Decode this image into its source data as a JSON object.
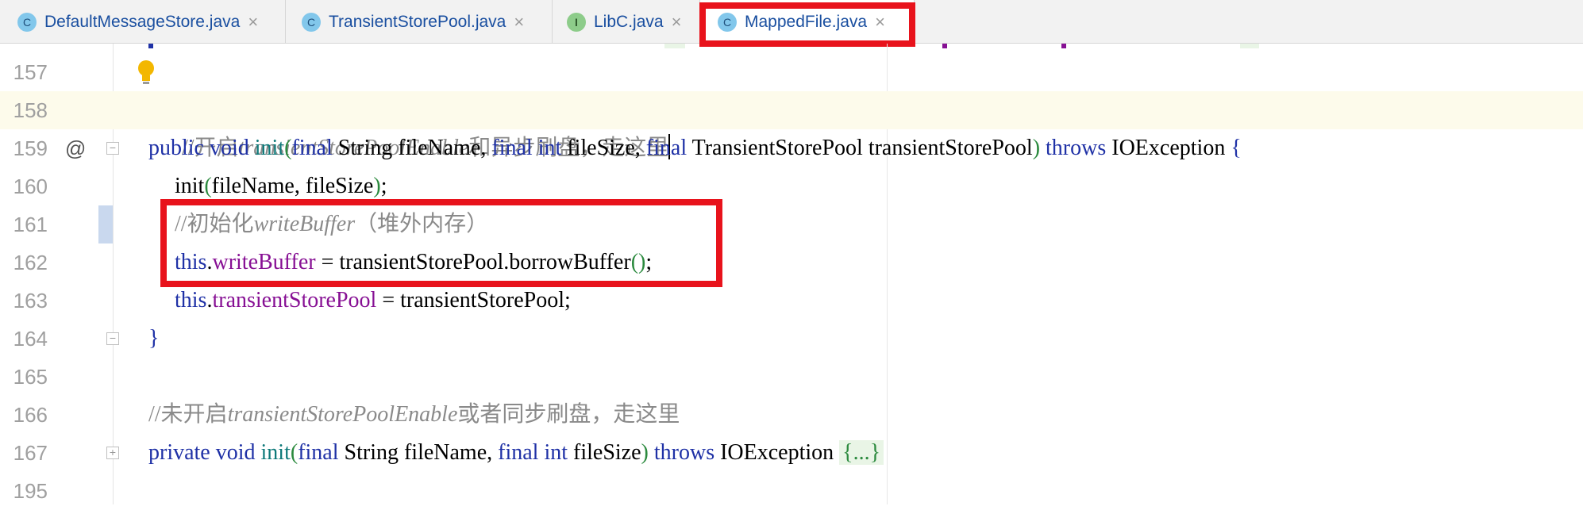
{
  "tabs": [
    {
      "icon_letter": "C",
      "label": "DefaultMessageStore.java",
      "close": "×"
    },
    {
      "icon_letter": "C",
      "label": "TransientStorePool.java",
      "close": "×"
    },
    {
      "icon_letter": "I",
      "label": "LibC.java",
      "close": "×"
    },
    {
      "icon_letter": "C",
      "label": "MappedFile.java",
      "close": "×",
      "active": true
    }
  ],
  "gutter": {
    "override_marker": "@"
  },
  "code_lines": {
    "l157": {
      "num": "157"
    },
    "l158": {
      "num": "158",
      "c1": "//开启",
      "c2": "transientStorePoolEnable",
      "c3": "和异步刷盘，走这里"
    },
    "l159": {
      "num": "159",
      "t1": "public",
      "t2": " ",
      "t3": "void",
      "t4": " ",
      "t5": "init",
      "t6": "(",
      "t7": "final",
      "t8": " String fileName, ",
      "t9": "final",
      "t10": " ",
      "t11": "int",
      "t12": " fileSize, ",
      "t13": "final",
      "t14": " TransientStorePool transientStorePool",
      "t15": ")",
      "t16": " ",
      "t17": "throws",
      "t18": " IOException ",
      "t19": "{"
    },
    "l160": {
      "num": "160",
      "t1": "init",
      "t2": "(",
      "t3": "fileName, fileSize",
      "t4": ")",
      "t5": ";"
    },
    "l161": {
      "num": "161",
      "c1": "//初始化",
      "c2": "writeBuffer",
      "c3": "（堆外内存）"
    },
    "l162": {
      "num": "162",
      "t1": "this",
      "t2": ".",
      "t3": "writeBuffer",
      "t4": " = transientStorePool.borrowBuffer",
      "t5": "()",
      "t6": ";"
    },
    "l163": {
      "num": "163",
      "t1": "this",
      "t2": ".",
      "t3": "transientStorePool",
      "t4": " = transientStorePool;"
    },
    "l164": {
      "num": "164",
      "t1": "}"
    },
    "l165": {
      "num": "165"
    },
    "l166": {
      "num": "166",
      "c1": "//未开启",
      "c2": "transientStorePoolEnable",
      "c3": "或者同步刷盘，走这里"
    },
    "l167": {
      "num": "167",
      "t1": "private",
      "t2": " ",
      "t3": "void",
      "t4": " ",
      "t5": "init",
      "t6": "(",
      "t7": "final",
      "t8": " String fileName, ",
      "t9": "final",
      "t10": " ",
      "t11": "int",
      "t12": " fileSize",
      "t13": ")",
      "t14": " ",
      "t15": "throws",
      "t16": " IOException ",
      "t17": "{...}"
    },
    "l195": {
      "num": "195"
    }
  },
  "colors": {
    "highlight_box": "#e8131c",
    "keyword": "#1f31a6",
    "field": "#871094",
    "comment": "#8a8a8a"
  }
}
